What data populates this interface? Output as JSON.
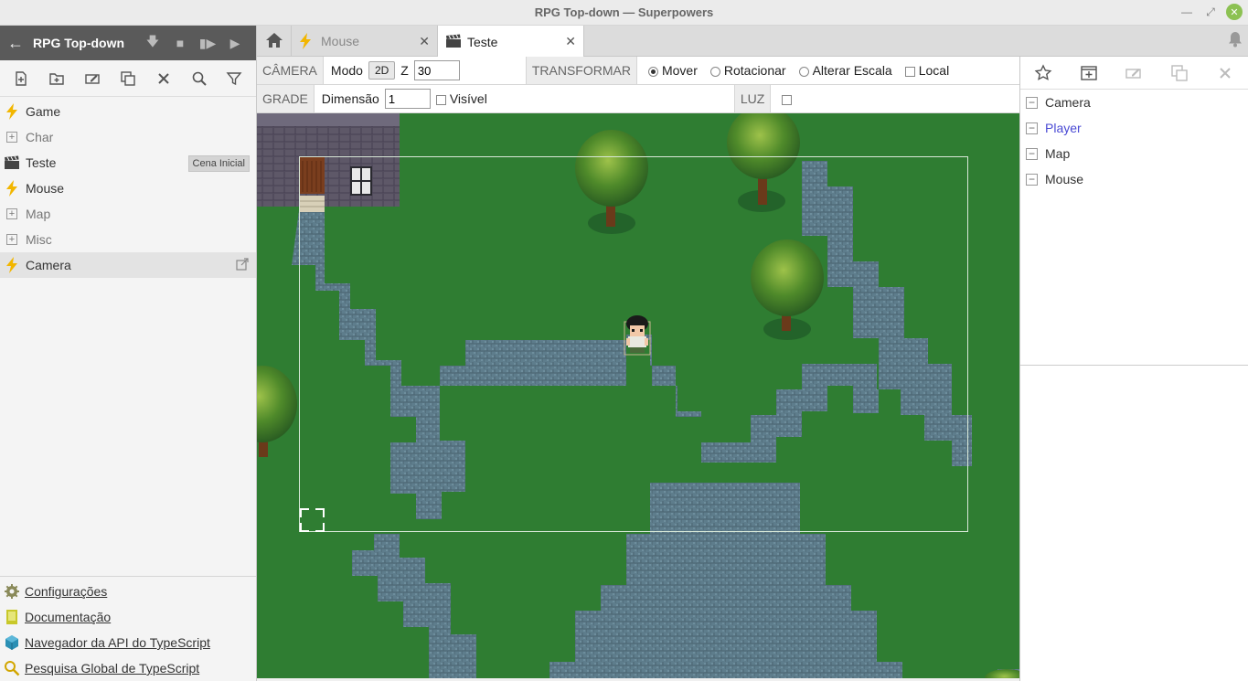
{
  "window": {
    "title": "RPG Top-down — Superpowers"
  },
  "project": {
    "name": "RPG Top-down"
  },
  "tree": [
    {
      "label": "Game",
      "kind": "script"
    },
    {
      "label": "Char",
      "kind": "folder"
    },
    {
      "label": "Teste",
      "kind": "scene",
      "badge": "Cena Inicial"
    },
    {
      "label": "Mouse",
      "kind": "script"
    },
    {
      "label": "Map",
      "kind": "folder"
    },
    {
      "label": "Misc",
      "kind": "folder"
    },
    {
      "label": "Camera",
      "kind": "script"
    }
  ],
  "bottom_links": [
    "Configurações",
    "Documentação",
    "Navegador da API do TypeScript",
    "Pesquisa Global de TypeScript"
  ],
  "tabs": [
    {
      "label": "Mouse",
      "icon": "bolt-icon"
    },
    {
      "label": "Teste",
      "icon": "clapperboard-icon"
    }
  ],
  "camera_bar": {
    "section": "CÂMERA",
    "mode_label": "Modo",
    "mode_value": "2D",
    "z_label": "Z",
    "z_value": "30"
  },
  "transform_bar": {
    "section": "TRANSFORMAR",
    "options": [
      "Mover",
      "Rotacionar",
      "Alterar Escala"
    ],
    "local_label": "Local"
  },
  "grid_bar": {
    "section": "GRADE",
    "dimension_label": "Dimensão",
    "dimension_value": "1",
    "visible_label": "Visível"
  },
  "light_bar": {
    "section": "LUZ"
  },
  "actors": [
    "Camera",
    "Player",
    "Map",
    "Mouse"
  ],
  "colors": {
    "grass": "#2f7d32",
    "path": "#5e7d8c",
    "accent_selected": "#4a4ad4",
    "bolt": "#f2b600"
  }
}
